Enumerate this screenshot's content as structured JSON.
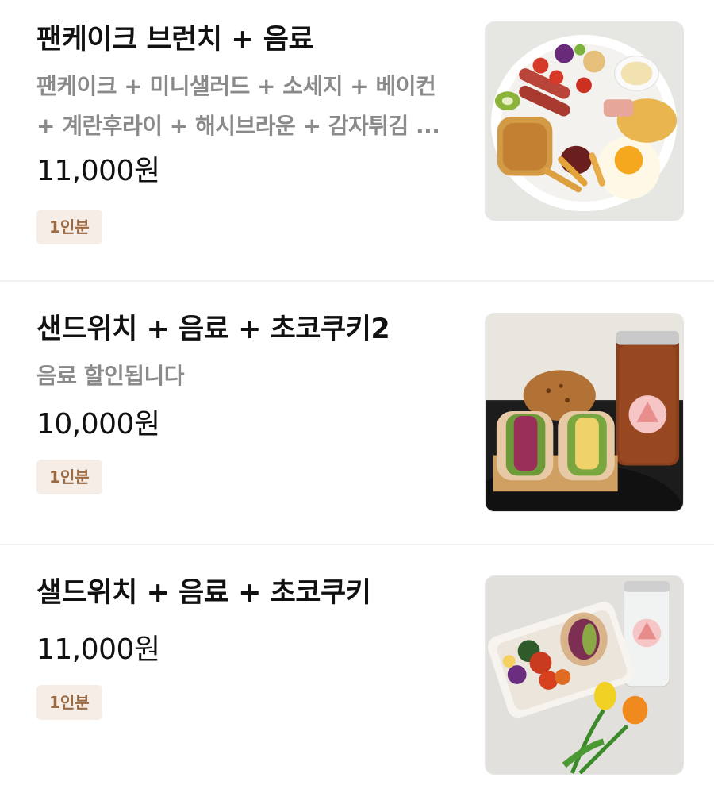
{
  "menu": {
    "items": [
      {
        "name": "팬케이크 브런치 + 음료",
        "description_lines": [
          "팬케이크 + 미니샐러드 + 소세지 + 베이컨",
          "+ 계란후라이 + 해시브라운 + 감자튀김 ..."
        ],
        "price": "11,000원",
        "badge": "1인분",
        "image_icon": "pancake-brunch-plate-photo"
      },
      {
        "name": "샌드위치 + 음료 + 초코쿠키2",
        "description_lines": [
          "음료 할인됩니다"
        ],
        "price": "10,000원",
        "badge": "1인분",
        "image_icon": "sandwich-drink-cookie-photo"
      },
      {
        "name": "샐드위치 + 음료 + 초코쿠키",
        "description_lines": [],
        "price": "11,000원",
        "badge": "1인분",
        "image_icon": "salad-sandwich-box-photo"
      }
    ]
  },
  "colors": {
    "badge_bg": "#f5ede6",
    "badge_text": "#9b6a43",
    "description": "#8a8a8a",
    "divider": "#f0f0f0"
  }
}
